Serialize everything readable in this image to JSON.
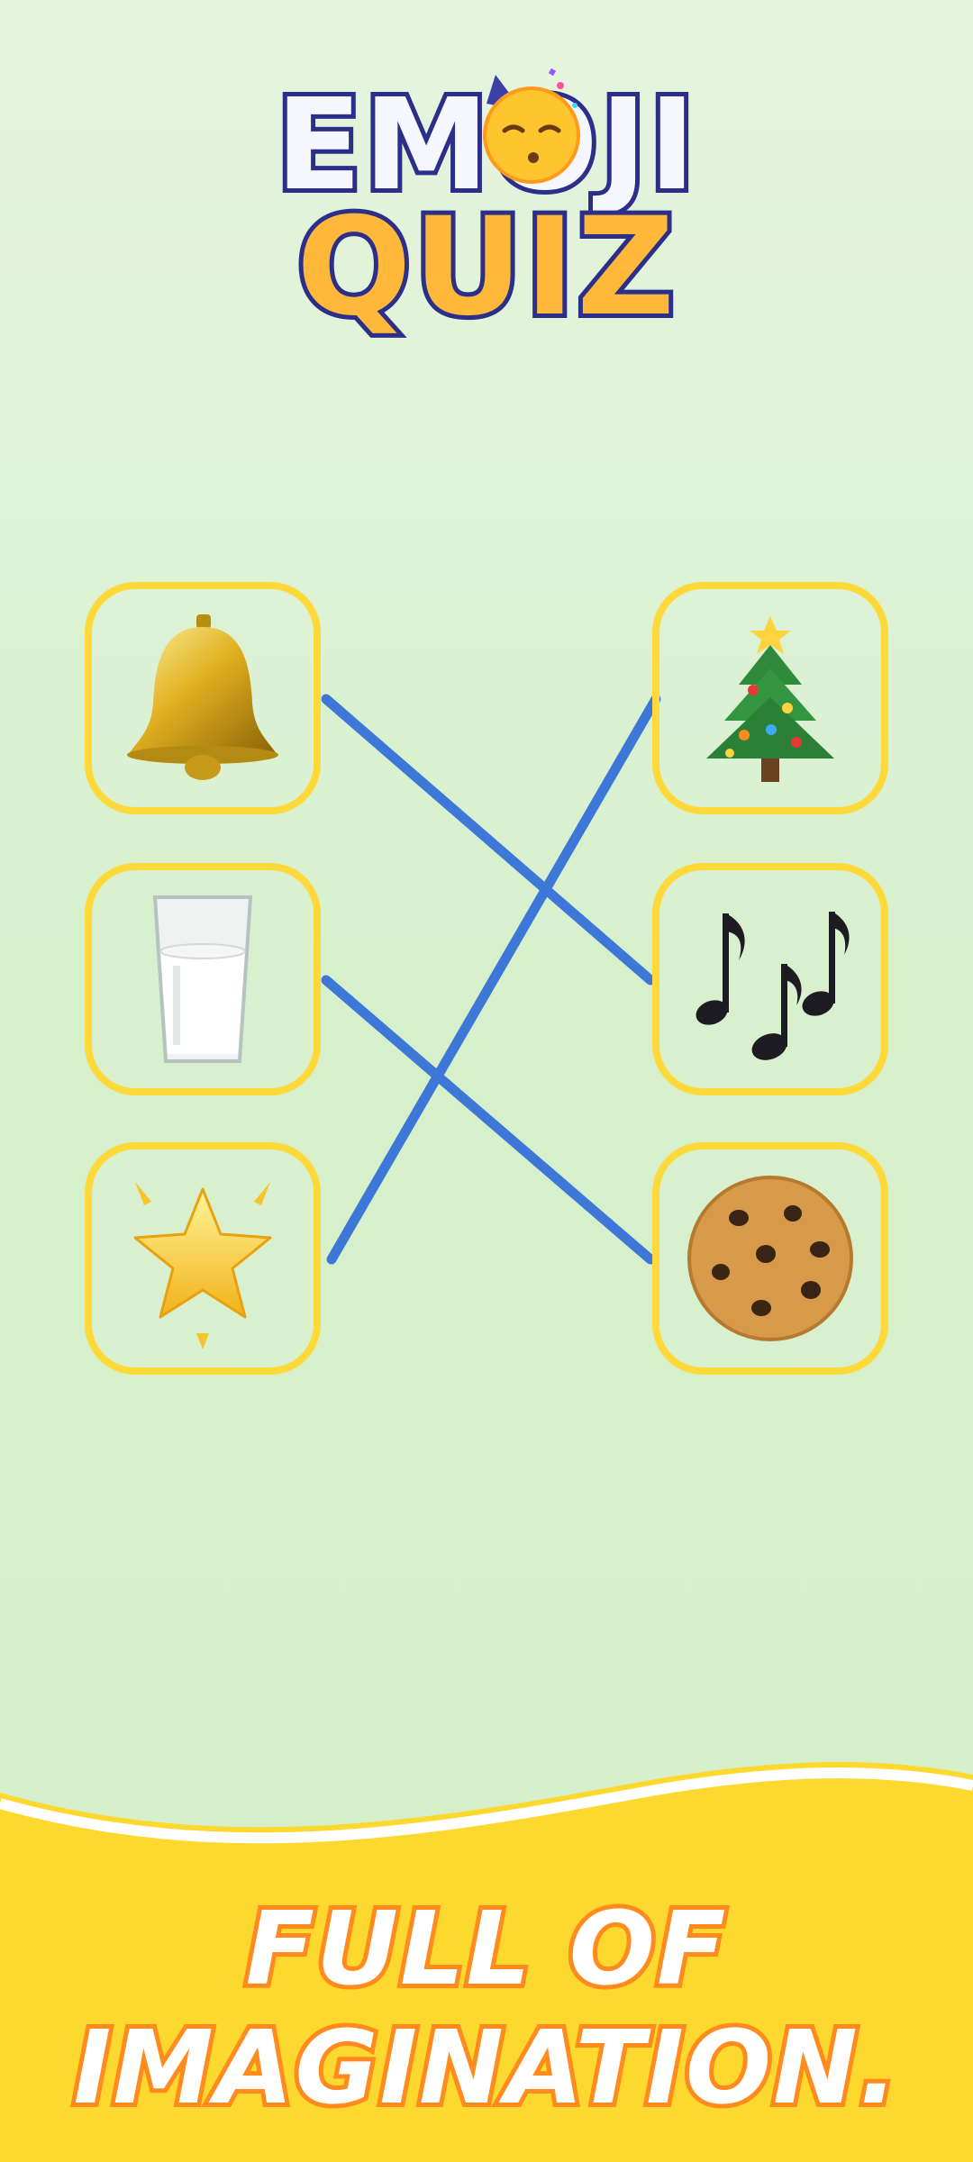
{
  "logo": {
    "line1": "EMOJI",
    "line2": "QUIZ"
  },
  "left_items": [
    {
      "name": "bell",
      "icon": "bell-icon"
    },
    {
      "name": "glass-of-milk",
      "icon": "milk-icon"
    },
    {
      "name": "glowing-star",
      "icon": "star-icon"
    }
  ],
  "right_items": [
    {
      "name": "christmas-tree",
      "icon": "christmas-tree-icon"
    },
    {
      "name": "musical-notes",
      "icon": "music-notes-icon"
    },
    {
      "name": "cookie",
      "icon": "cookie-icon"
    }
  ],
  "connections": [
    {
      "from": "bell",
      "to": "musical-notes"
    },
    {
      "from": "glass-of-milk",
      "to": "cookie"
    },
    {
      "from": "glowing-star",
      "to": "christmas-tree"
    }
  ],
  "colors": {
    "card_border": "#ffd93a",
    "line": "#3d78d8",
    "banner": "#fdd92f",
    "slogan_stroke": "#ff8a1e"
  },
  "slogan": {
    "line1": "FULL OF",
    "line2": "IMAGINATION."
  }
}
